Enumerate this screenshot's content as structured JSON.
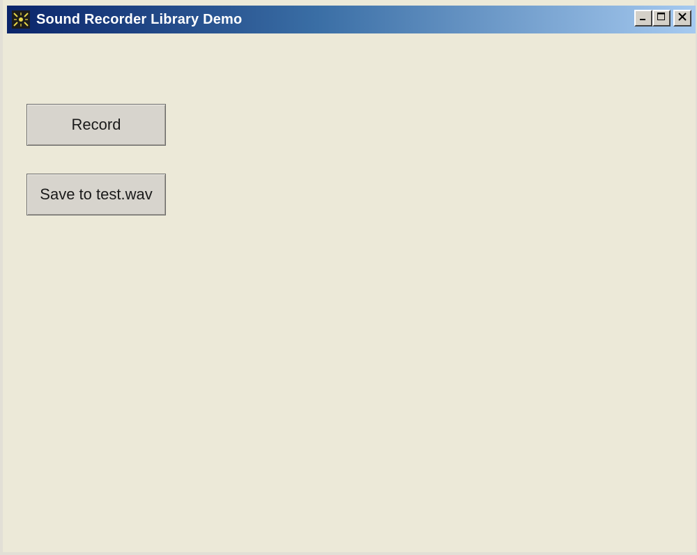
{
  "window": {
    "title": "Sound Recorder Library Demo"
  },
  "title_controls": {
    "minimize_icon": "minimize-icon",
    "maximize_icon": "maximize-icon",
    "close_icon": "close-icon"
  },
  "buttons": {
    "record_label": "Record",
    "save_label": "Save to test.wav"
  },
  "colors": {
    "titlebar_start": "#0a246a",
    "titlebar_end": "#a6caf0",
    "client_background": "#ece9d8",
    "button_face": "#d7d4cd"
  }
}
